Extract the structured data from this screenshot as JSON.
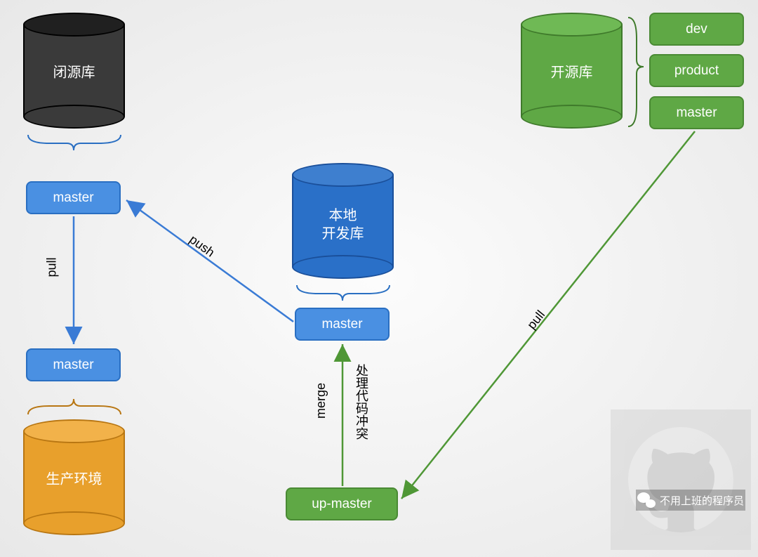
{
  "cylinders": {
    "closed_repo": {
      "label": "闭源库",
      "color": "#3a3a3a"
    },
    "local_repo": {
      "label": "本地\n开发库",
      "color": "#2a70c8"
    },
    "open_repo": {
      "label": "开源库",
      "color": "#5fa845"
    },
    "prod_env": {
      "label": "生产环境",
      "color": "#e8a02c"
    }
  },
  "boxes": {
    "closed_master": {
      "label": "master"
    },
    "prod_master": {
      "label": "master"
    },
    "local_master": {
      "label": "master"
    },
    "up_master": {
      "label": "up-master"
    },
    "open_dev": {
      "label": "dev"
    },
    "open_product": {
      "label": "product"
    },
    "open_master": {
      "label": "master"
    }
  },
  "edges": {
    "closed_to_prod": {
      "label": "pull"
    },
    "local_to_closed": {
      "label": "push"
    },
    "up_to_local": {
      "label": "merge",
      "side_label": "处理代码冲突"
    },
    "open_to_up": {
      "label": "pull"
    }
  },
  "watermark": {
    "text": "不用上班的程序员"
  }
}
